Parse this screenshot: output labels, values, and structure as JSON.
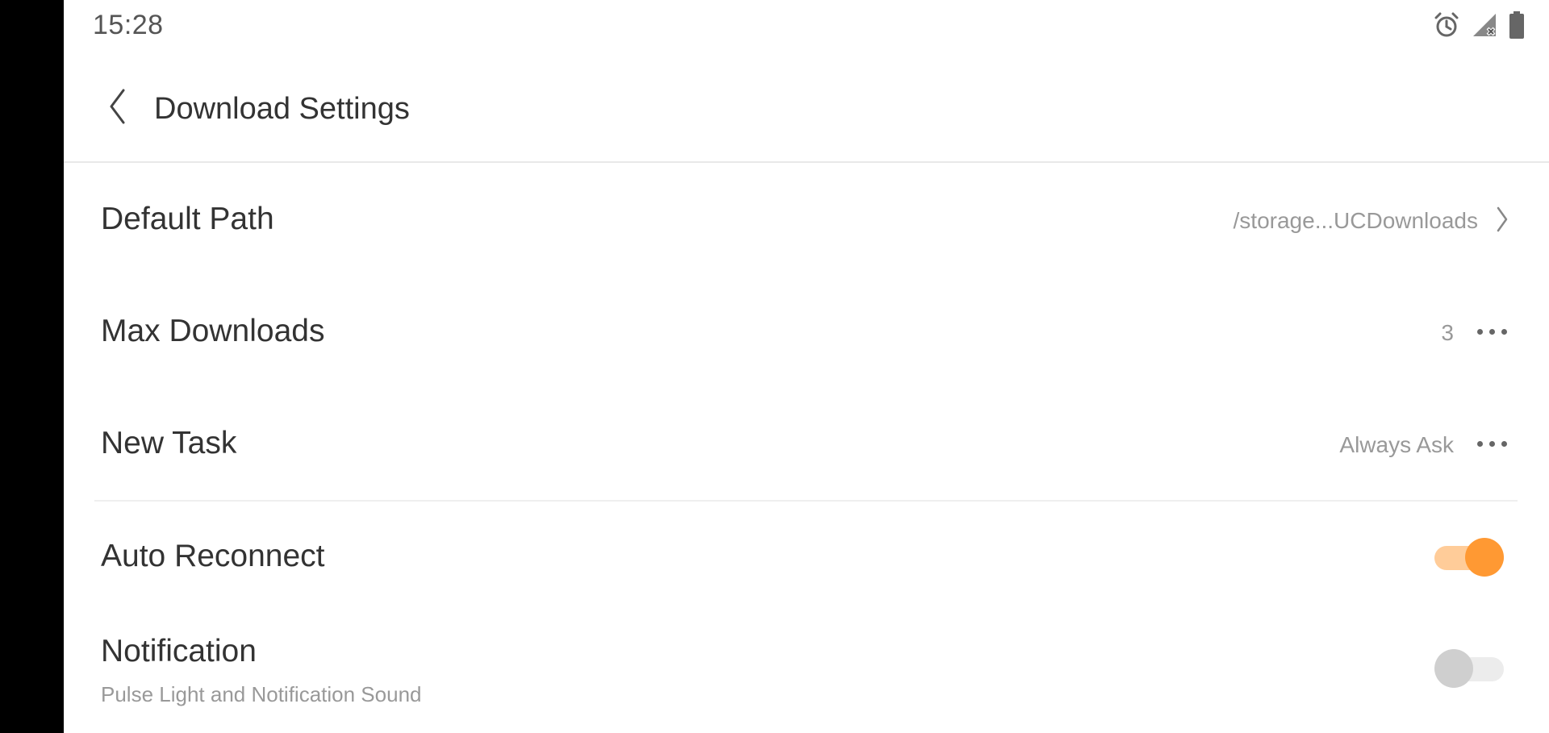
{
  "status_bar": {
    "time": "15:28",
    "icons": [
      "alarm-icon",
      "signal-no-service-icon",
      "battery-icon"
    ]
  },
  "header": {
    "back_icon": "chevron-left-icon",
    "title": "Download Settings"
  },
  "settings": {
    "default_path": {
      "label": "Default Path",
      "value": "/storage...UCDownloads",
      "end_icon": "chevron-right-icon"
    },
    "max_downloads": {
      "label": "Max Downloads",
      "value": "3",
      "end_icon": "more-dots-icon"
    },
    "new_task": {
      "label": "New Task",
      "value": "Always Ask",
      "end_icon": "more-dots-icon"
    },
    "auto_reconnect": {
      "label": "Auto Reconnect",
      "enabled": true
    },
    "notification": {
      "label": "Notification",
      "subtitle": "Pulse Light and Notification Sound",
      "enabled": false
    }
  },
  "colors": {
    "accent": "#ff9933",
    "accent_track": "#ffcc99",
    "text_primary": "#333333",
    "text_secondary": "#999999"
  }
}
